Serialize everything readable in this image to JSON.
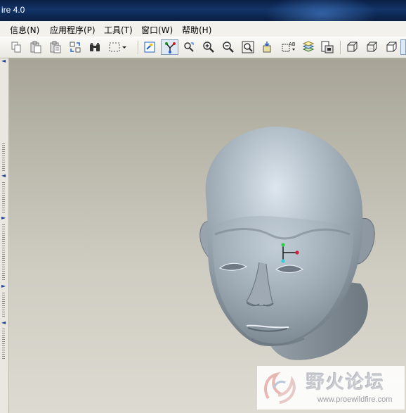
{
  "titlebar": {
    "title": "ire 4.0"
  },
  "menu": [
    {
      "label": "信息(N)"
    },
    {
      "label": "应用程序(P)"
    },
    {
      "label": "工具(T)"
    },
    {
      "label": "窗口(W)"
    },
    {
      "label": "帮助(H)"
    }
  ],
  "toolbar": {
    "icons": [
      "copy-icon",
      "paste-icon",
      "paste-special-icon",
      "regenerate-icon",
      "find-binoculars-icon",
      "select-box-icon",
      "redraw-icon",
      "spin-center-icon",
      "orient-mode-icon",
      "zoom-in-icon",
      "zoom-out-icon",
      "refit-icon",
      "reorient-icon",
      "saved-views-icon",
      "layers-icon",
      "model-tree-icon",
      "wireframe-icon",
      "hidden-line-icon",
      "no-hidden-icon",
      "shading-icon"
    ]
  },
  "watermark": {
    "title": "野火论坛",
    "url": "www.proewildfire.com"
  }
}
